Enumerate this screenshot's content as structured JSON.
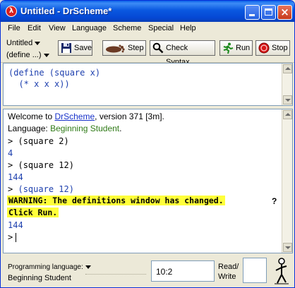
{
  "window": {
    "title": "Untitled - DrScheme*",
    "app_icon": "lambda-icon",
    "controls": [
      "minimize",
      "maximize",
      "close"
    ]
  },
  "menu": [
    "File",
    "Edit",
    "View",
    "Language",
    "Scheme",
    "Special",
    "Help"
  ],
  "toolbar": {
    "doc_name": "Untitled",
    "define_menu": "(define ...)",
    "buttons": {
      "save": "Save",
      "step": "Step",
      "check_syntax": "Check Syntax",
      "run": "Run",
      "stop": "Stop"
    }
  },
  "definitions": {
    "lines": [
      "(define (square x)",
      "  (* x x x))"
    ]
  },
  "interactions": {
    "welcome_prefix": "Welcome to ",
    "welcome_link": "DrScheme",
    "welcome_suffix": ", version 371 [3m].",
    "language_prefix": "Language: ",
    "language_name": "Beginning Student",
    "language_suffix": ".",
    "prompt": ">",
    "expr1": "(square 2)",
    "result1": "4",
    "expr2": "(square 12)",
    "result2": "144",
    "expr3": "(square 12)",
    "warning_line1": "WARNING: The definitions window has changed.",
    "warning_line2": "Click Run.",
    "warning_mark": "?",
    "result3": "144"
  },
  "status": {
    "language_label": "Programming language:",
    "language_value": "Beginning Student",
    "position": "10:2",
    "read_write": [
      "Read/",
      "Write"
    ]
  },
  "colors": {
    "titlebar": "#0a58e0",
    "code": "#1d3fae",
    "language": "#2f7a17",
    "warning_bg": "#ffff3a"
  }
}
